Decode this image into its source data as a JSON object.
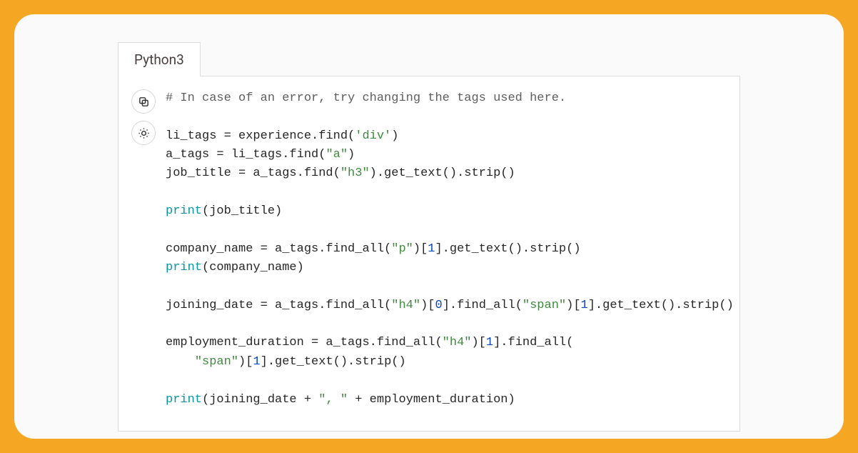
{
  "tab": {
    "label": "Python3"
  },
  "code": {
    "c1_comment": "# In case of an error, try changing the tags used here.",
    "l3_pre": "li_tags = experience.find(",
    "l3_str": "'div'",
    "l3_post": ")",
    "l4_pre": "a_tags = li_tags.find(",
    "l4_str": "\"a\"",
    "l4_post": ")",
    "l5_pre": "job_title = a_tags.find(",
    "l5_str": "\"h3\"",
    "l5_post": ").get_text().strip()",
    "print": "print",
    "l7_arg": "(job_title)",
    "l9_pre": "company_name = a_tags.find_all(",
    "l9_str": "\"p\"",
    "l9_mid": ")[",
    "l9_num": "1",
    "l9_post": "].get_text().strip()",
    "l10_arg": "(company_name)",
    "l12_pre": "joining_date = a_tags.find_all(",
    "l12_str1": "\"h4\"",
    "l12_mid1": ")[",
    "l12_num1": "0",
    "l12_mid2": "].find_all(",
    "l12_str2": "\"span\"",
    "l12_mid3": ")[",
    "l12_num2": "1",
    "l12_post": "].get_text().strip()",
    "l14_pre": "employment_duration = a_tags.find_all(",
    "l14_str": "\"h4\"",
    "l14_mid": ")[",
    "l14_num": "1",
    "l14_post": "].find_all(",
    "l15_indent": "    ",
    "l15_str": "\"span\"",
    "l15_mid": ")[",
    "l15_num": "1",
    "l15_post": "].get_text().strip()",
    "l17_open": "(joining_date + ",
    "l17_str": "\", \"",
    "l17_close": " + employment_duration)"
  }
}
